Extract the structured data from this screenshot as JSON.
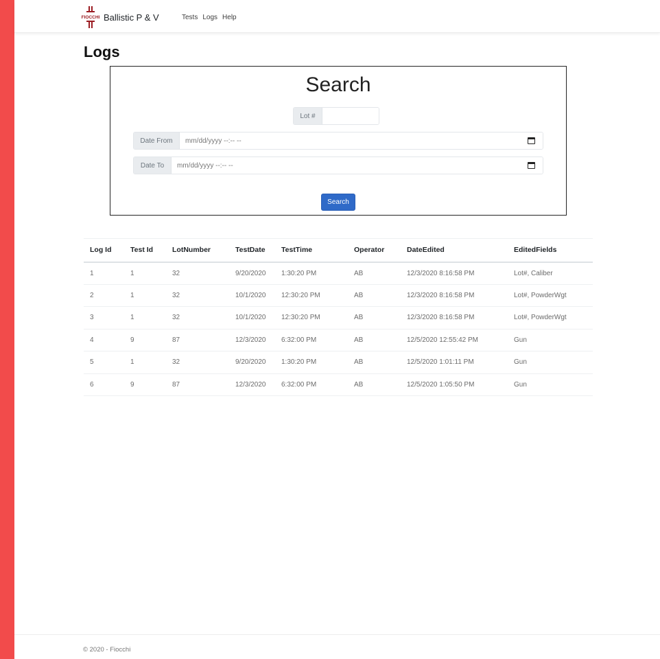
{
  "colors": {
    "accent_red": "#f24b4b",
    "primary_button": "#2f6ac8",
    "logo_red": "#9b1c22"
  },
  "navbar": {
    "logo_text": "FIOCCHI",
    "brand": "Ballistic P & V",
    "links": [
      "Tests",
      "Logs",
      "Help"
    ]
  },
  "page": {
    "title": "Logs"
  },
  "search": {
    "title": "Search",
    "lot_label": "Lot #",
    "lot_value": "",
    "date_from_label": "Date From",
    "date_from_placeholder": "mm/dd/yyyy --:-- --",
    "date_to_label": "Date To",
    "date_to_placeholder": "mm/dd/yyyy --:-- --",
    "button_label": "Search",
    "calendar_icon": "calendar-icon"
  },
  "table": {
    "headers": [
      "Log Id",
      "Test Id",
      "LotNumber",
      "TestDate",
      "TestTime",
      "Operator",
      "DateEdited",
      "EditedFields"
    ],
    "rows": [
      [
        "1",
        "1",
        "32",
        "9/20/2020",
        "1:30:20 PM",
        "AB",
        "12/3/2020 8:16:58 PM",
        "Lot#, Caliber"
      ],
      [
        "2",
        "1",
        "32",
        "10/1/2020",
        "12:30:20 PM",
        "AB",
        "12/3/2020 8:16:58 PM",
        "Lot#, PowderWgt"
      ],
      [
        "3",
        "1",
        "32",
        "10/1/2020",
        "12:30:20 PM",
        "AB",
        "12/3/2020 8:16:58 PM",
        "Lot#, PowderWgt"
      ],
      [
        "4",
        "9",
        "87",
        "12/3/2020",
        "6:32:00 PM",
        "AB",
        "12/5/2020 12:55:42 PM",
        "Gun"
      ],
      [
        "5",
        "1",
        "32",
        "9/20/2020",
        "1:30:20 PM",
        "AB",
        "12/5/2020 1:01:11 PM",
        "Gun"
      ],
      [
        "6",
        "9",
        "87",
        "12/3/2020",
        "6:32:00 PM",
        "AB",
        "12/5/2020 1:05:50 PM",
        "Gun"
      ]
    ]
  },
  "footer": {
    "text": "© 2020 - Fiocchi"
  }
}
